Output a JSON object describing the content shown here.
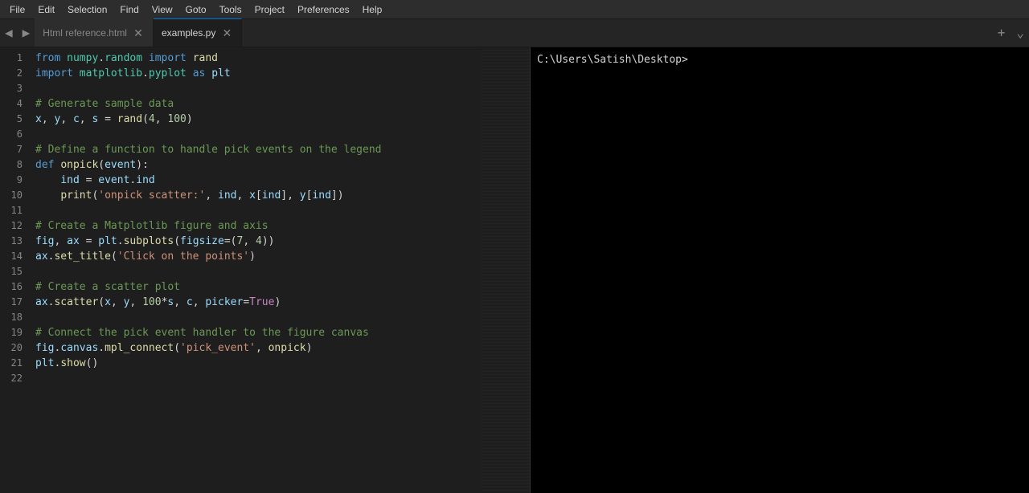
{
  "menubar": {
    "items": [
      "File",
      "Edit",
      "Selection",
      "Find",
      "View",
      "Goto",
      "Tools",
      "Project",
      "Preferences",
      "Help"
    ]
  },
  "tabbar": {
    "nav_back": "◀",
    "nav_forward": "▶",
    "tabs": [
      {
        "label": "Html reference.html",
        "active": false,
        "closeable": true
      },
      {
        "label": "examples.py",
        "active": true,
        "closeable": true
      }
    ],
    "add_tab": "+"
  },
  "editor": {
    "lines": [
      {
        "num": 1,
        "code": "from numpy.random import rand"
      },
      {
        "num": 2,
        "code": "import matplotlib.pyplot as plt"
      },
      {
        "num": 3,
        "code": ""
      },
      {
        "num": 4,
        "code": "# Generate sample data"
      },
      {
        "num": 5,
        "code": "x, y, c, s = rand(4, 100)"
      },
      {
        "num": 6,
        "code": ""
      },
      {
        "num": 7,
        "code": "# Define a function to handle pick events on the legend"
      },
      {
        "num": 8,
        "code": "def onpick(event):"
      },
      {
        "num": 9,
        "code": "    ind = event.ind"
      },
      {
        "num": 10,
        "code": "    print('onpick scatter:', ind, x[ind], y[ind])"
      },
      {
        "num": 11,
        "code": ""
      },
      {
        "num": 12,
        "code": "# Create a Matplotlib figure and axis"
      },
      {
        "num": 13,
        "code": "fig, ax = plt.subplots(figsize=(7, 4))"
      },
      {
        "num": 14,
        "code": "ax.set_title('Click on the points')"
      },
      {
        "num": 15,
        "code": ""
      },
      {
        "num": 16,
        "code": "# Create a scatter plot"
      },
      {
        "num": 17,
        "code": "ax.scatter(x, y, 100*s, c, picker=True)"
      },
      {
        "num": 18,
        "code": ""
      },
      {
        "num": 19,
        "code": "# Connect the pick event handler to the figure canvas"
      },
      {
        "num": 20,
        "code": "fig.canvas.mpl_connect('pick_event', onpick)"
      },
      {
        "num": 21,
        "code": "plt.show()"
      },
      {
        "num": 22,
        "code": ""
      }
    ]
  },
  "terminal": {
    "path": "C:\\Users\\Satish\\Desktop>"
  }
}
